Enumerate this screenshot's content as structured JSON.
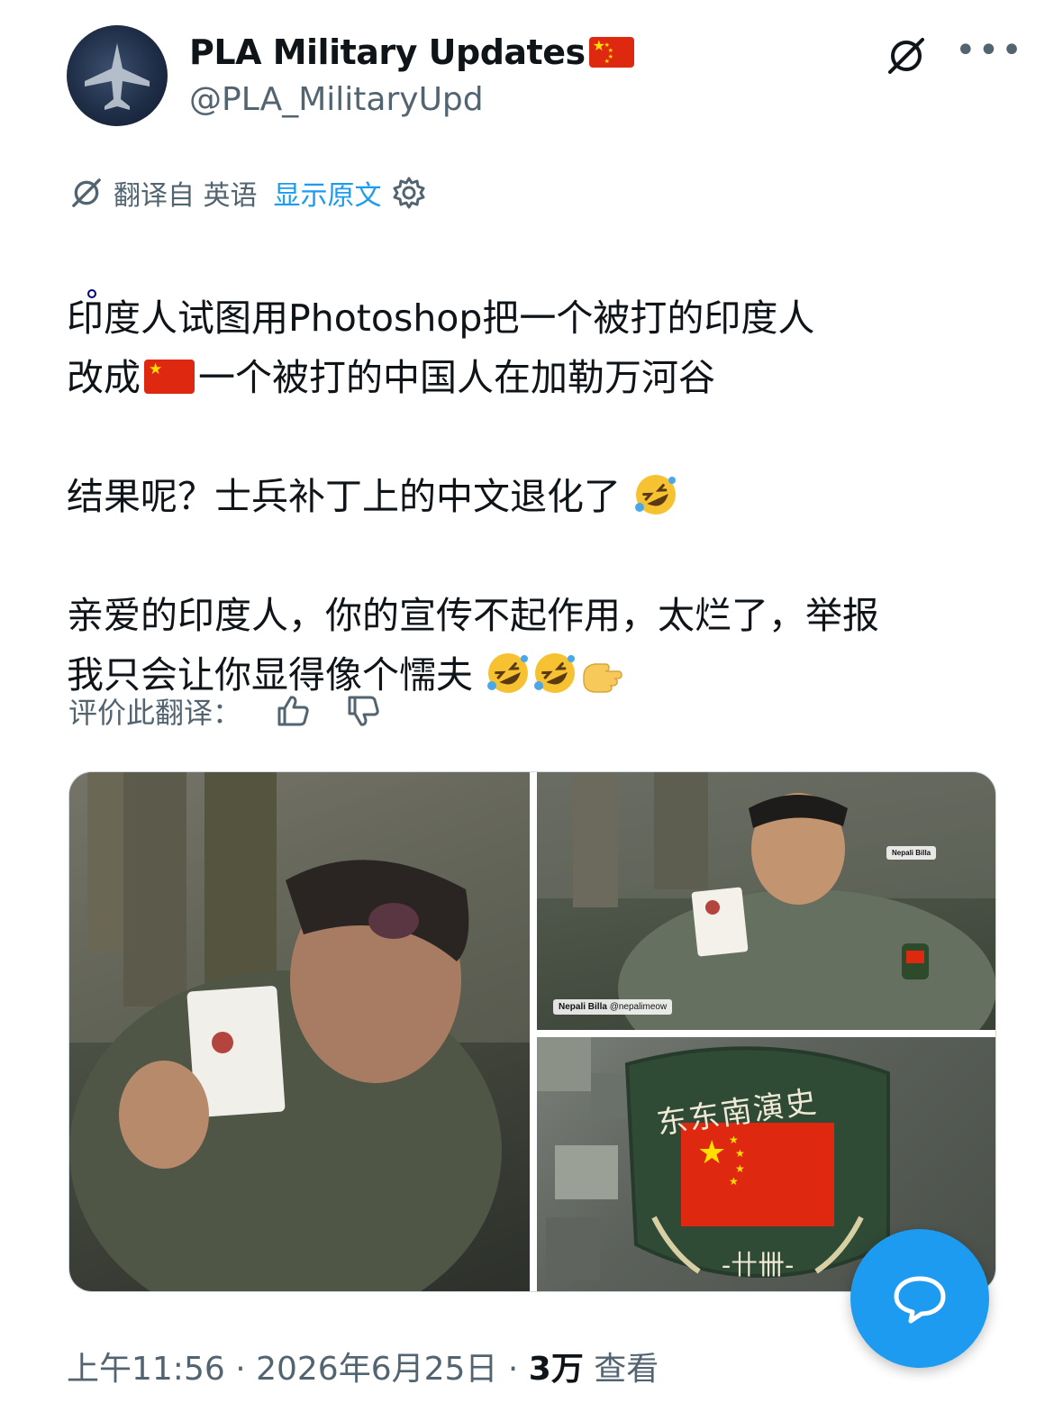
{
  "header": {
    "display_name": "PLA Military Updates",
    "handle": "@PLA_MilitaryUpd"
  },
  "translation": {
    "label": "翻译自 英语",
    "show_original": "显示原文"
  },
  "tweet": {
    "line1": "印度人试图用Photoshop把一个被打的印度人",
    "line2a": "改成",
    "line2b": "一个被打的中国人在加勒万河谷",
    "line3": "结果呢？士兵补丁上的中文退化了",
    "line4": "亲爱的印度人，你的宣传不起作用，太烂了，举报",
    "line5": "我只会让你显得像个懦夫"
  },
  "rating": {
    "label": "评价此翻译："
  },
  "media": {
    "watermark_name": "Nepali Billa",
    "watermark_handle": "@nepalimeow",
    "patch_text": "东东南演史",
    "patch_number": "-卄卌-"
  },
  "footer": {
    "time": "上午11:56",
    "date": "2026年6月25日",
    "views_count": "3万",
    "views_label": "查看"
  },
  "colors": {
    "accent": "#1d9bf0",
    "secondary_text": "#536471",
    "primary_text": "#0f1419"
  }
}
